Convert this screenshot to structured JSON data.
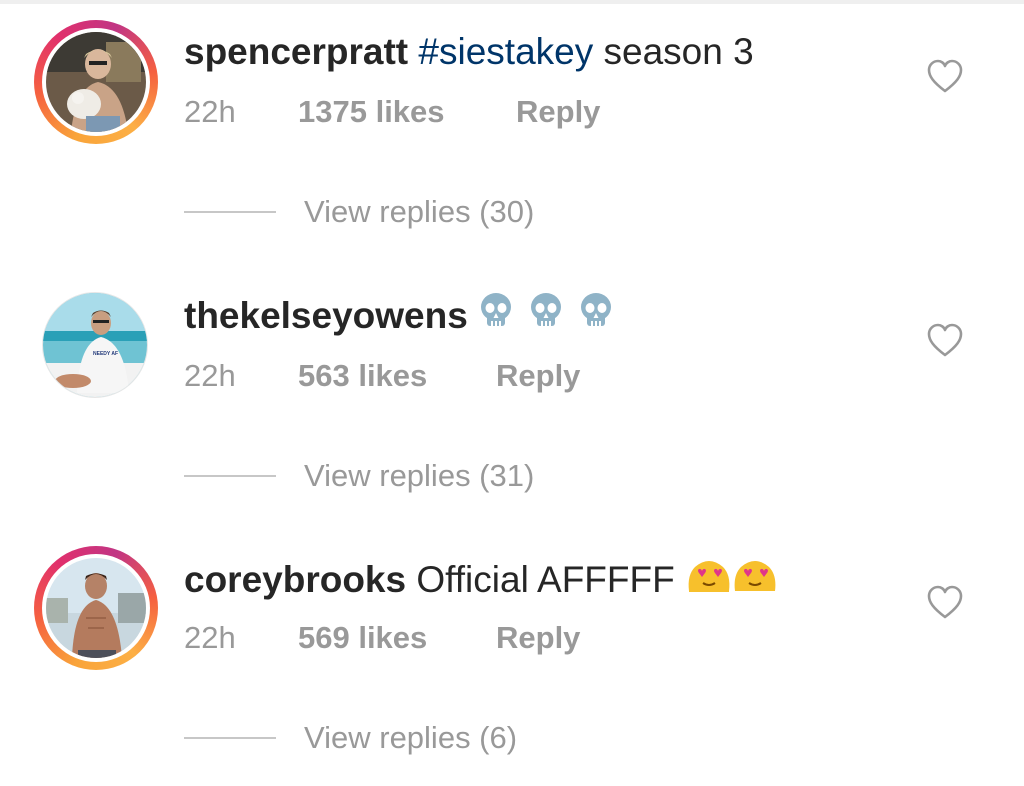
{
  "comments": [
    {
      "username": "spencerpratt",
      "hashtag": "#siestakey",
      "text": " season 3",
      "time": "22h",
      "likes": "1375 likes",
      "reply": "Reply",
      "view_replies": "View replies (30)",
      "has_story_ring": true,
      "emoji": []
    },
    {
      "username": "thekelseyowens",
      "text": "",
      "time": "22h",
      "likes": "563 likes",
      "reply": "Reply",
      "view_replies": "View replies (31)",
      "has_story_ring": false,
      "emoji": [
        "skull-emoji",
        "skull-emoji",
        "skull-emoji"
      ]
    },
    {
      "username": "coreybrooks",
      "text": "Official AFFFFF",
      "time": "22h",
      "likes": "569 likes",
      "reply": "Reply",
      "view_replies": "View replies (6)",
      "has_story_ring": true,
      "emoji": [
        "heart-eyes-emoji",
        "heart-eyes-emoji"
      ]
    }
  ],
  "colors": {
    "username": "#262626",
    "hashtag": "#003569",
    "meta": "#999999",
    "story_ring": "#e1306c"
  }
}
